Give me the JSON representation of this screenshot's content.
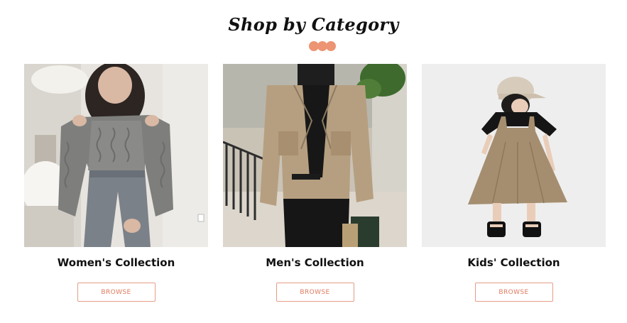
{
  "section": {
    "title": "Shop by Category",
    "accent_color": "#ec9473"
  },
  "categories": [
    {
      "title": "Women's Collection",
      "button_label": "BROWSE",
      "image_alt": "Woman in grey cable knit sweater and jeans"
    },
    {
      "title": "Men's Collection",
      "button_label": "BROWSE",
      "image_alt": "Man in beige cargo jacket and black trousers"
    },
    {
      "title": "Kids' Collection",
      "button_label": "BROWSE",
      "image_alt": "Child in beige pinafore dress and cap"
    }
  ]
}
